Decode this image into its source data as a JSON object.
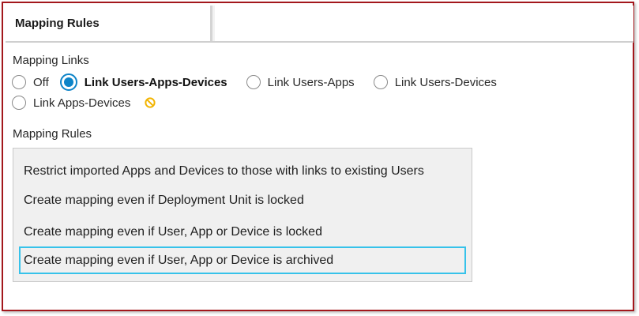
{
  "header": {
    "tab_title": "Mapping Rules"
  },
  "mapping_links": {
    "label": "Mapping Links",
    "options_row1": [
      {
        "label": "Off",
        "checked": false
      },
      {
        "label": "Link Users-Apps-Devices",
        "checked": true
      },
      {
        "label": "Link Users-Apps",
        "checked": false
      },
      {
        "label": "Link Users-Devices",
        "checked": false
      }
    ],
    "options_row2": [
      {
        "label": "Link Apps-Devices",
        "checked": false
      }
    ],
    "warning_icon": "no-entry-icon",
    "accent_color": "#0d84c8",
    "warning_color": "#f2b400"
  },
  "mapping_rules": {
    "label": "Mapping Rules",
    "items": [
      {
        "label": "Restrict imported Apps and Devices to those with links to existing Users",
        "selected": false
      },
      {
        "label": "Create mapping even if Deployment Unit is locked",
        "selected": false
      },
      {
        "label": "Create mapping even if User, App or Device is locked",
        "selected": false
      },
      {
        "label": "Create mapping even if User, App or Device is archived",
        "selected": true
      }
    ],
    "selection_color": "#36c2ea"
  },
  "frame_color": "#a3171c"
}
